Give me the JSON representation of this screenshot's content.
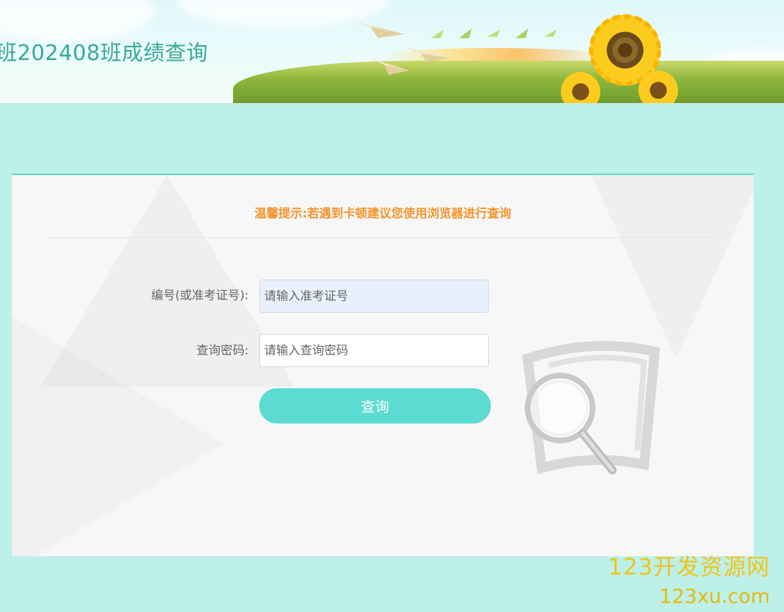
{
  "header": {
    "title": "班202408班成绩查询"
  },
  "notice": {
    "text": "温馨提示:若遇到卡顿建议您使用浏览器进行查询"
  },
  "form": {
    "id_label": "编号(或准考证号):",
    "id_placeholder": "请输入准考证号",
    "id_value": "",
    "password_label": "查询密码:",
    "password_placeholder": "请输入查询密码",
    "password_value": "",
    "submit_label": "查询"
  },
  "watermark": {
    "line1": "123开发资源网",
    "line2": "123xu.com"
  },
  "colors": {
    "page_background": "#bdf0e8",
    "accent": "#5cdbd1",
    "notice": "#f2952e",
    "title": "#3aa89b",
    "watermark": "#f0c419"
  },
  "icons": {
    "banner_decoration": "sunflower-field-banner",
    "magnifier": "magnifier-icon"
  }
}
